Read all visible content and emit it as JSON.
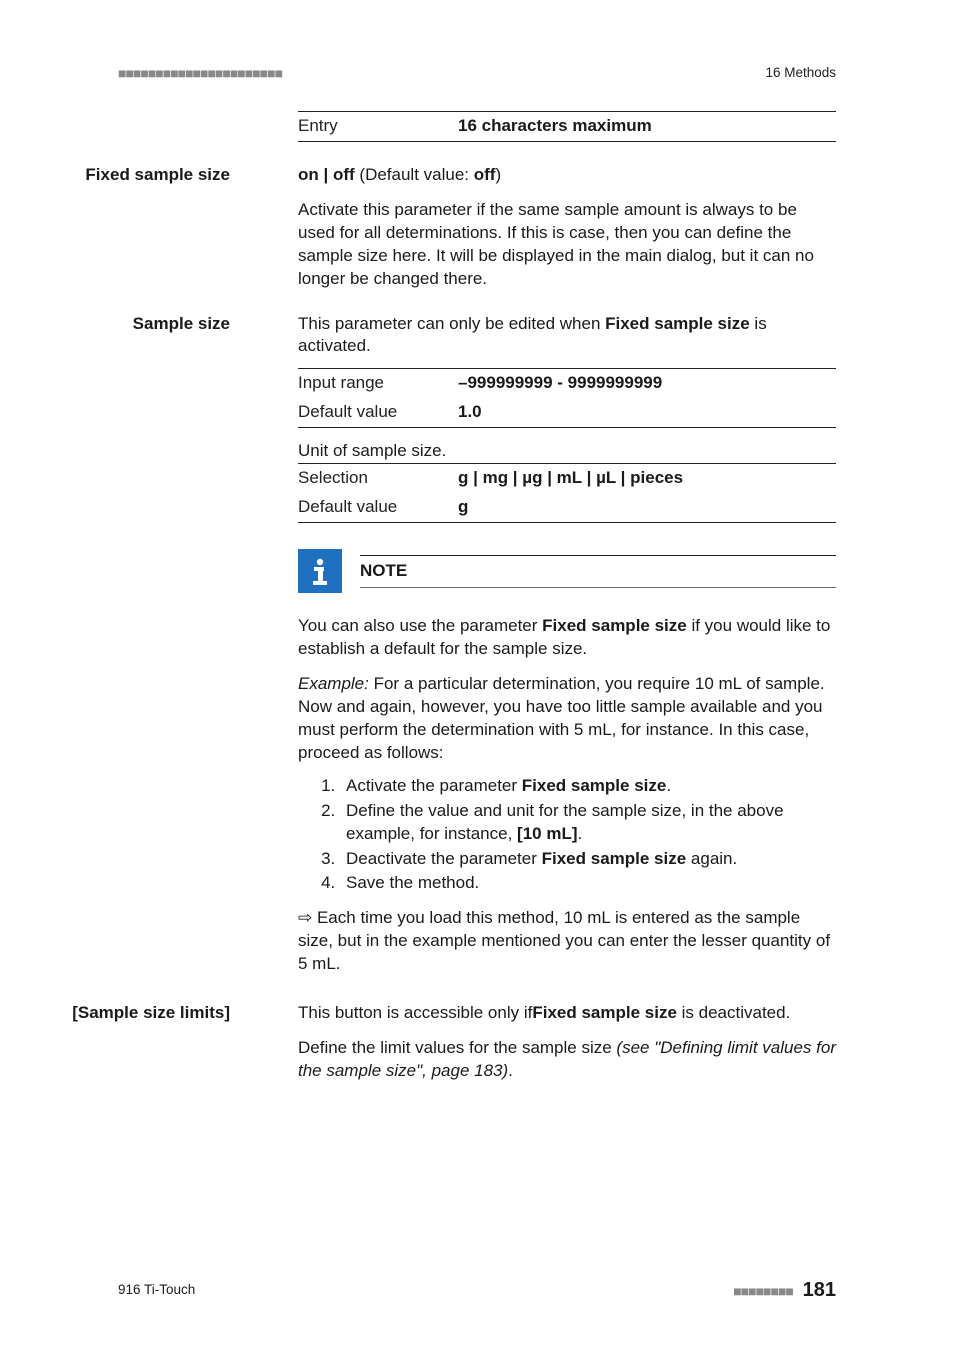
{
  "header": {
    "dashes": "■■■■■■■■■■■■■■■■■■■■■■",
    "right": "16 Methods"
  },
  "entry_table": {
    "label": "Entry",
    "value": "16 characters maximum"
  },
  "fixed_sample_size": {
    "label": "Fixed sample size",
    "toggle_prefix": "on | off",
    "default_label": " (Default value: ",
    "default_value": "off",
    "close_paren": ")",
    "description": "Activate this parameter if the same sample amount is always to be used for all determinations. If this is case, then you can define the sample size here. It will be displayed in the main dialog, but it can no longer be changed there."
  },
  "sample_size": {
    "label": "Sample size",
    "intro_prefix": "This parameter can only be edited when ",
    "intro_bold": "Fixed sample size",
    "intro_suffix": " is activated.",
    "range_table": {
      "r1k": "Input range",
      "r1v": "–999999999 - 9999999999",
      "r2k": "Default value",
      "r2v": "1.0"
    },
    "unit_caption": "Unit of sample size.",
    "unit_table": {
      "r1k": "Selection",
      "r1v": "g | mg | µg | mL | µL | pieces",
      "r2k": "Default value",
      "r2v": "g"
    }
  },
  "note": {
    "title": "NOTE",
    "p1_prefix": "You can also use the parameter ",
    "p1_bold": "Fixed sample size",
    "p1_suffix": " if you would like to establish a default for the sample size.",
    "p2_lead": "Example:",
    "p2_body": " For a particular determination, you require 10 mL of sample. Now and again, however, you have too little sample available and you must perform the determination with 5 mL, for instance. In this case, proceed as follows:",
    "steps": {
      "s1_prefix": "Activate the parameter ",
      "s1_bold": "Fixed sample size",
      "s1_suffix": ".",
      "s2_prefix": "Define the value and unit for the sample size, in the above example, for instance, ",
      "s2_bold": "[10 mL]",
      "s2_suffix": ".",
      "s3_prefix": "Deactivate the parameter ",
      "s3_bold": "Fixed sample size",
      "s3_suffix": " again.",
      "s4": "Save the method."
    },
    "result_arrow": "⇨",
    "result_body": " Each time you load this method, 10 mL is entered as the sample size, but in the example mentioned you can enter the lesser quantity of 5 mL."
  },
  "sample_size_limits": {
    "label": "[Sample size limits]",
    "p1_prefix": "This button is accessible only if",
    "p1_bold": "Fixed sample size",
    "p1_suffix": " is deactivated.",
    "p2_prefix": "Define the limit values for the sample size ",
    "p2_italic": "(see \"Defining limit values for the sample size\", page 183)",
    "p2_suffix": "."
  },
  "footer": {
    "left": "916 Ti-Touch",
    "dashes": "■■■■■■■■",
    "page": "181"
  }
}
